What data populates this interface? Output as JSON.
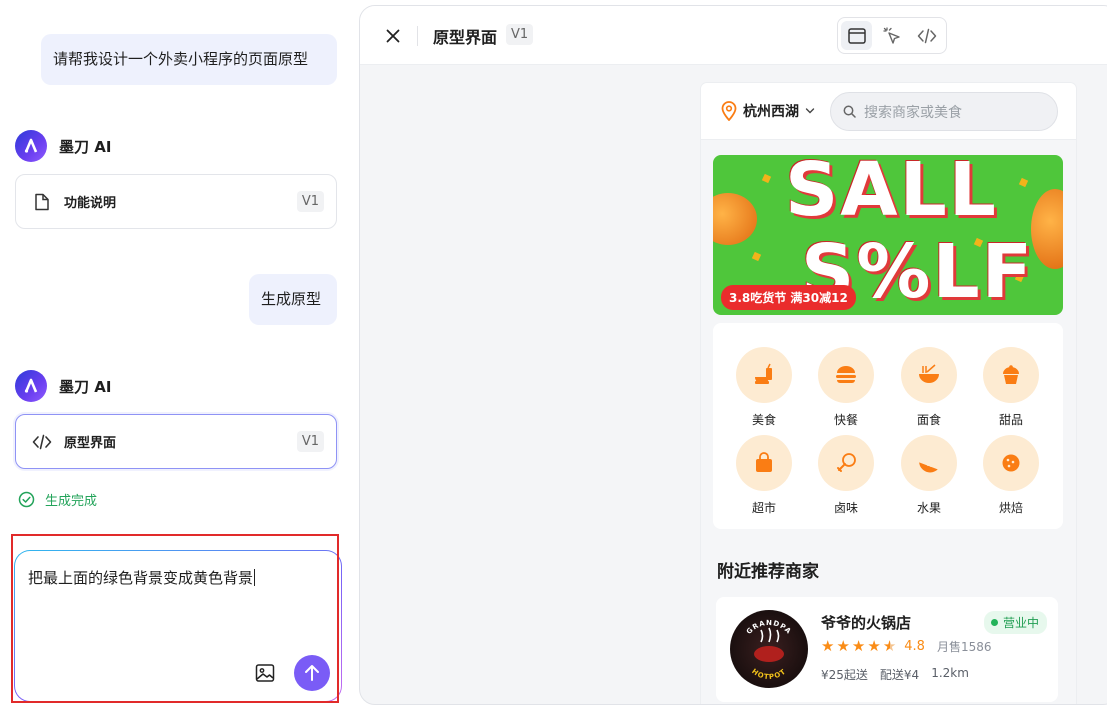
{
  "chat": {
    "user_msg_1": "请帮我设计一个外卖小程序的页面原型",
    "ai_name_1": "墨刀 AI",
    "card_1": {
      "label": "功能说明",
      "version": "V1"
    },
    "user_msg_2": "生成原型",
    "ai_name_2": "墨刀 AI",
    "card_2": {
      "label": "原型界面",
      "version": "V1"
    },
    "status": "生成完成",
    "input_value": "把最上面的绿色背景变成黄色背景",
    "accent_color": "#7a5cf6"
  },
  "preview": {
    "title": "原型界面",
    "version": "V1",
    "view_modes": [
      "preview-icon",
      "cursor-icon",
      "code-icon"
    ],
    "phone": {
      "location": "杭州西湖",
      "search_placeholder": "搜索商家或美食",
      "banner": {
        "line1": "SALL",
        "line2": "S%LF",
        "tag": "3.8吃货节 满30减12",
        "bg_color": "#4fc63b"
      },
      "categories": [
        {
          "label": "美食",
          "icon": "food-icon"
        },
        {
          "label": "快餐",
          "icon": "burger-icon"
        },
        {
          "label": "面食",
          "icon": "noodle-icon"
        },
        {
          "label": "甜品",
          "icon": "cupcake-icon"
        },
        {
          "label": "超市",
          "icon": "shopping-bag-icon"
        },
        {
          "label": "卤味",
          "icon": "drumstick-icon"
        },
        {
          "label": "水果",
          "icon": "watermelon-icon"
        },
        {
          "label": "烘焙",
          "icon": "cookie-icon"
        }
      ],
      "section_title": "附近推荐商家",
      "shop": {
        "name": "爷爷的火锅店",
        "status": "营业中",
        "rating": "4.8",
        "stars": 4.5,
        "sold": "月售1586",
        "min_order": "¥25起送",
        "delivery_fee": "配送¥4",
        "distance": "1.2km",
        "logo_text_top": "GRANDPA",
        "logo_text_bottom": "HOTPOT"
      }
    }
  }
}
